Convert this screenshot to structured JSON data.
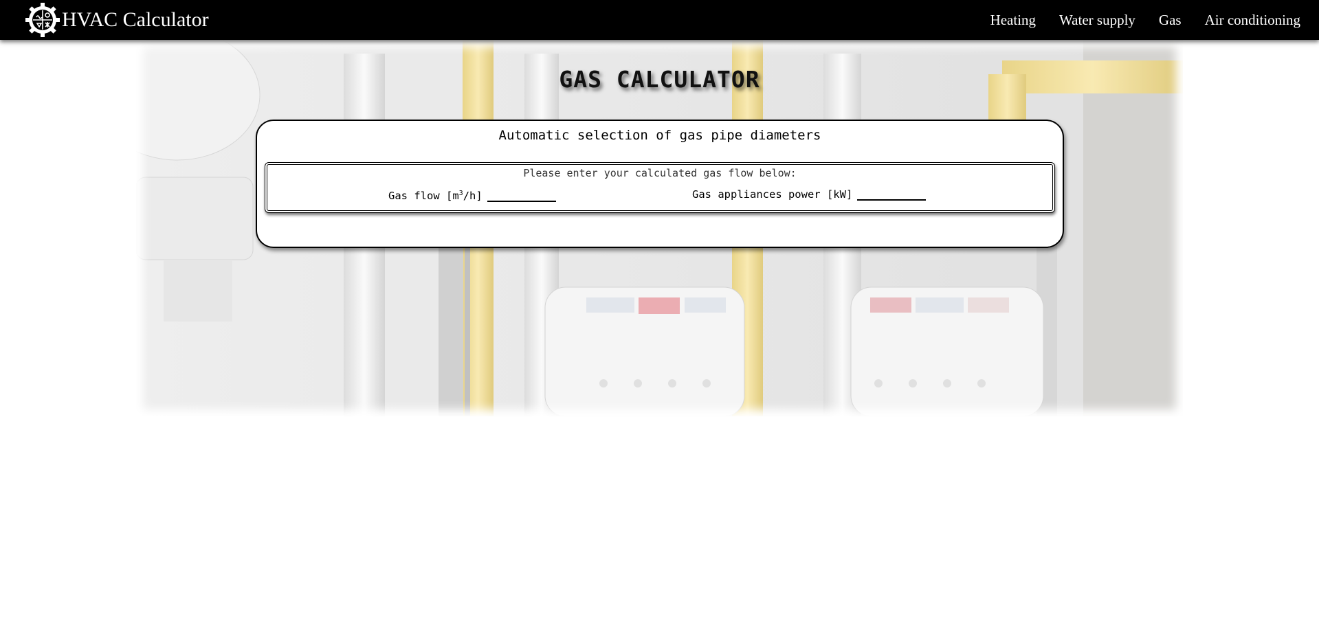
{
  "header": {
    "brand_title": "HVAC Calculator",
    "logo_icon": "gear-logo-icon",
    "nav": [
      {
        "label": "Heating"
      },
      {
        "label": "Water supply"
      },
      {
        "label": "Gas"
      },
      {
        "label": "Air conditioning"
      }
    ]
  },
  "hero": {
    "title": "GAS CALCULATOR",
    "background": "gas-meters-photo"
  },
  "card": {
    "heading": "Automatic selection of gas pipe diameters",
    "instruction": "Please enter your calculated gas flow below:",
    "fields": {
      "gas_flow": {
        "label_prefix": "Gas flow [m",
        "label_sup": "3",
        "label_suffix": "/h]",
        "value": ""
      },
      "power": {
        "label": "Gas appliances power [kW]",
        "value": ""
      }
    }
  },
  "colors": {
    "navbar_bg": "#000000",
    "nav_text": "#ffffff",
    "card_border": "#000000",
    "pipe_yellow": "#f3dc8a"
  }
}
